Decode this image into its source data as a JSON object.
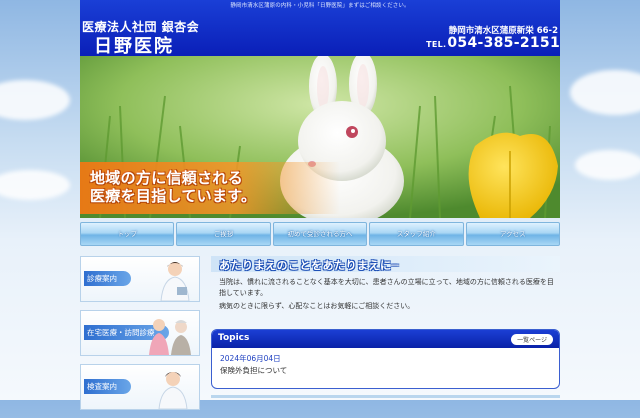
{
  "header": {
    "tagline": "静岡市清水区蒲原の内科・小児科「日野医院」まずはご相談ください。",
    "corp_name": "医療法人社団 銀杏会",
    "clinic_name": "日野医院",
    "address": "静岡市清水区蒲原新栄 66-2",
    "tel_prefix": "TEL.",
    "tel_number": "054-385-2151"
  },
  "hero": {
    "caption_line1": "地域の方に信頼される",
    "caption_line2": "医療を目指しています。"
  },
  "nav": {
    "items": [
      {
        "label": "トップ"
      },
      {
        "label": "ご挨拶"
      },
      {
        "label": "初めて受診される方へ"
      },
      {
        "label": "スタッフ紹介"
      },
      {
        "label": "アクセス"
      }
    ]
  },
  "sidebar": {
    "items": [
      {
        "label": "診療案内"
      },
      {
        "label": "在宅医療・訪問診療"
      },
      {
        "label": "検査案内"
      }
    ]
  },
  "main": {
    "banner": "あたりまえのことをあたりまえに─",
    "intro_1": "当院は、慣れに流されることなく基本を大切に、患者さんの立場に立って、地域の方に信頼される医療を目指しています。",
    "intro_2": "病気のときに限らず、心配なことはお気軽にご相談ください。",
    "topics": {
      "title": "Topics",
      "more_label": "一覧ページ",
      "date": "2024年06月04日",
      "text": "保険外負担について"
    }
  },
  "colors": {
    "header_blue": "#0a1fb8",
    "accent_orange": "#ee7814",
    "nav_light_blue": "#a9d6f4"
  }
}
